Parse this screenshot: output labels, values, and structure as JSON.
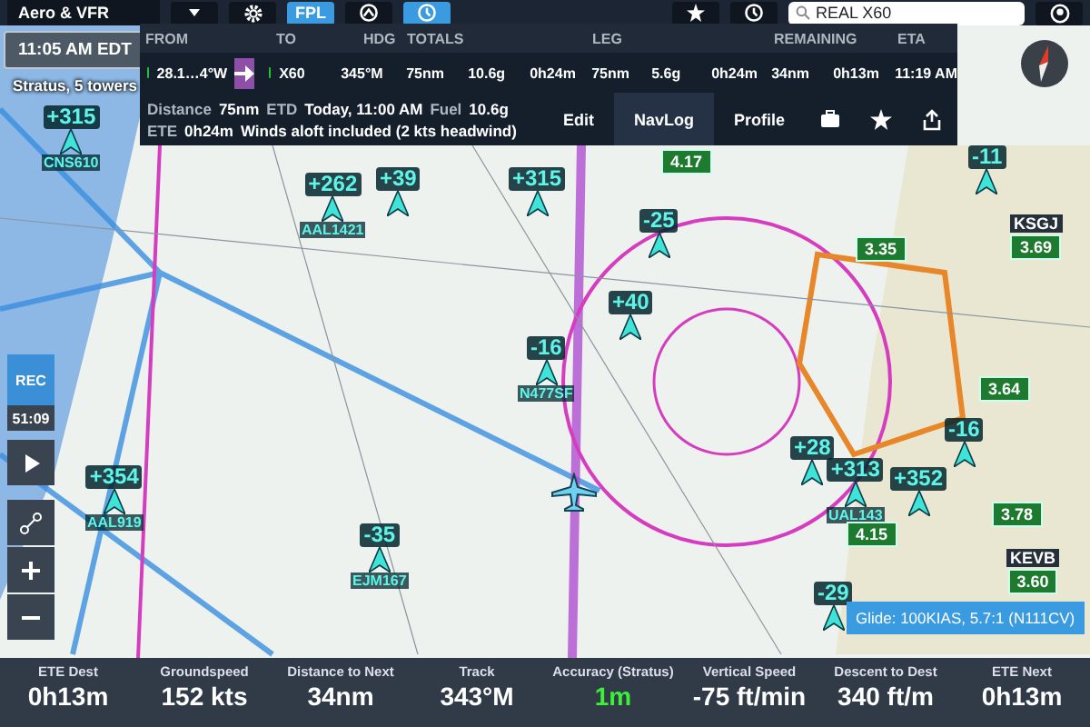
{
  "top_bar": {
    "layers": "Aero & VFR",
    "buttons": [
      {
        "kind": "text",
        "label": "FPL",
        "selected": true
      },
      {
        "kind": "icon",
        "selected": false
      },
      {
        "kind": "icon",
        "selected": true
      }
    ],
    "search": {
      "value": "REAL X60"
    }
  },
  "status": {
    "time": "11:05 AM EDT",
    "source": "Stratus, 5 towers"
  },
  "flight_plan": {
    "columns": [
      "FROM",
      "TO",
      "HDG",
      "TOTALS",
      "LEG",
      "REMAINING",
      "ETA"
    ],
    "from": "28.1…4°W",
    "to": "X60",
    "hdg": "345°M",
    "totals": [
      "75nm",
      "10.6g",
      "0h24m"
    ],
    "leg": [
      "75nm",
      "5.6g",
      "0h24m"
    ],
    "remaining": [
      "34nm",
      "0h13m"
    ],
    "eta": "11:19 AM",
    "details": [
      [
        {
          "label": "Distance",
          "value": "75nm"
        },
        {
          "label": "ETD",
          "value": "Today, 11:00 AM"
        },
        {
          "label": "Fuel",
          "value": "10.6g"
        }
      ],
      [
        {
          "label": "ETE",
          "value": "0h24m"
        },
        {
          "value": "Winds aloft included (2 kts headwind)"
        }
      ]
    ],
    "tabs": [
      {
        "label": "Edit",
        "selected": false
      },
      {
        "label": "NavLog",
        "selected": true
      },
      {
        "label": "Profile",
        "selected": false
      }
    ]
  },
  "recorder": {
    "label": "REC",
    "time": "51:09"
  },
  "traffic": [
    {
      "altitude": "+315",
      "callsign": "CNS610"
    },
    {
      "altitude": "+262",
      "callsign": "AAL1421"
    },
    {
      "altitude": "+39"
    },
    {
      "altitude": "+315"
    },
    {
      "altitude": "-11"
    },
    {
      "altitude": "+354",
      "callsign": "AAL919"
    },
    {
      "altitude": "-35",
      "callsign": "EJM167"
    },
    {
      "altitude": "+28"
    },
    {
      "altitude": "+313",
      "callsign": "UAL143"
    },
    {
      "altitude": "-16"
    },
    {
      "altitude": "+352"
    },
    {
      "altitude": "-29"
    },
    {
      "altitude": "-25"
    },
    {
      "altitude": "+40"
    },
    {
      "altitude": "-16",
      "callsign": "N477SF"
    }
  ],
  "airports": [
    {
      "id": "KSGJ",
      "value": "3.69"
    },
    {
      "value": "4.17"
    },
    {
      "value": "3.35"
    },
    {
      "value": "3.64"
    },
    {
      "value": "3.78"
    },
    {
      "id": "KEVB",
      "value": "3.60"
    },
    {
      "value": "4.15"
    }
  ],
  "glide": "Glide: 100KIAS, 5.7:1 (N111CV)",
  "instruments": [
    {
      "label": "ETE Dest",
      "value": "0h13m",
      "highlight": false
    },
    {
      "label": "Groundspeed",
      "value": "152 kts",
      "highlight": false
    },
    {
      "label": "Distance to Next",
      "value": "34nm",
      "highlight": false
    },
    {
      "label": "Track",
      "value": "343°M",
      "highlight": false
    },
    {
      "label": "Accuracy (Stratus)",
      "value": "1m",
      "highlight": true
    },
    {
      "label": "Vertical Speed",
      "value": "-75 ft/min",
      "highlight": false
    },
    {
      "label": "Descent to Dest",
      "value": "340 ft/m",
      "highlight": false
    },
    {
      "label": "ETE Next",
      "value": "0h13m",
      "highlight": false
    }
  ]
}
